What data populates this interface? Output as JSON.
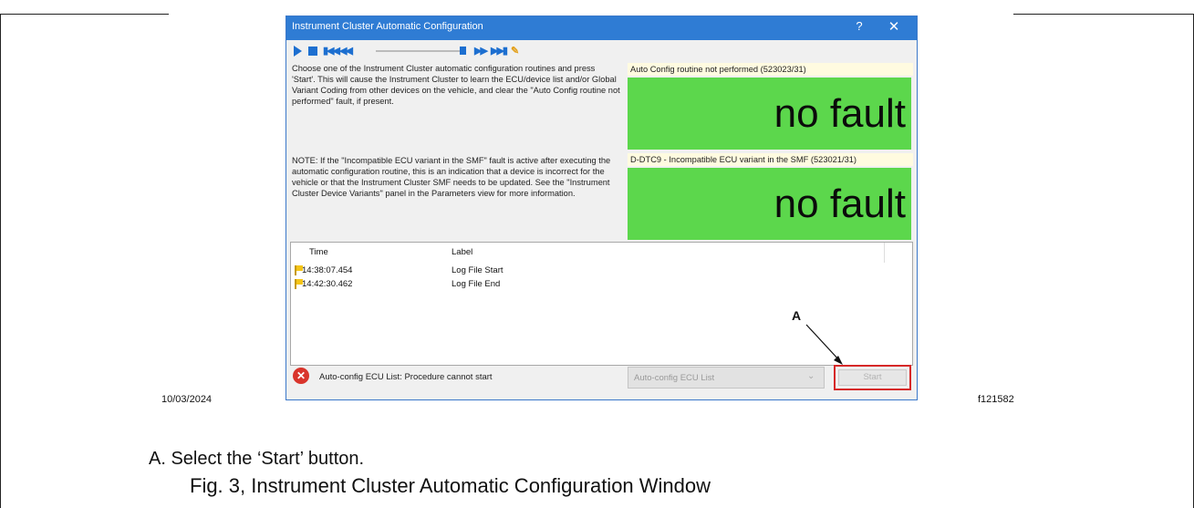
{
  "window": {
    "title": "Instrument Cluster Automatic Configuration",
    "help_label": "?",
    "close_label": "✕"
  },
  "toolbar": {
    "icons": [
      "play-icon",
      "stop-icon",
      "skip-to-start-icon",
      "rewind-icon",
      "position-slider",
      "fast-forward-icon",
      "skip-to-end-icon",
      "settings-tool-icon"
    ]
  },
  "description": "Choose one of the Instrument Cluster automatic configuration routines and press 'Start'. This will cause the Instrument Cluster to learn the ECU/device list and/or Global Variant Coding from other devices on the vehicle, and clear the \"Auto Config routine not performed\" fault, if present.",
  "note": "NOTE: If the \"Incompatible ECU variant in the SMF\" fault is active after executing the automatic configuration routine, this is an indication that a device is incorrect for the vehicle or that the Instrument Cluster SMF needs to be updated. See the \"Instrument Cluster Device Variants\" panel in the Parameters view for more information.",
  "faults": [
    {
      "label": "Auto Config routine not performed (523023/31)",
      "status": "no fault"
    },
    {
      "label": "D-DTC9 - Incompatible ECU variant in the SMF (523021/31)",
      "status": "no fault"
    }
  ],
  "log": {
    "headers": {
      "time": "Time",
      "label": "Label"
    },
    "rows": [
      {
        "time": "14:38:07.454",
        "label": "Log File Start"
      },
      {
        "time": "14:42:30.462",
        "label": "Log File End"
      }
    ]
  },
  "status": {
    "icon": "error-icon",
    "icon_glyph": "✕",
    "text": "Auto-config ECU List: Procedure cannot start"
  },
  "routine_select": {
    "value": "Auto-config ECU List",
    "chevron": "⌄"
  },
  "start_button": {
    "label": "Start"
  },
  "callout": "A",
  "doc": {
    "date": "10/03/2024",
    "figure_id": "f121582",
    "caption_a": "A. Select the ‘Start’ button.",
    "figure_caption": "Fig. 3, Instrument Cluster Automatic Configuration Window"
  },
  "colors": {
    "titlebar": "#2f7cd4",
    "fault_ok": "#5cd74c",
    "highlight": "#d62828",
    "error": "#d9342b"
  }
}
